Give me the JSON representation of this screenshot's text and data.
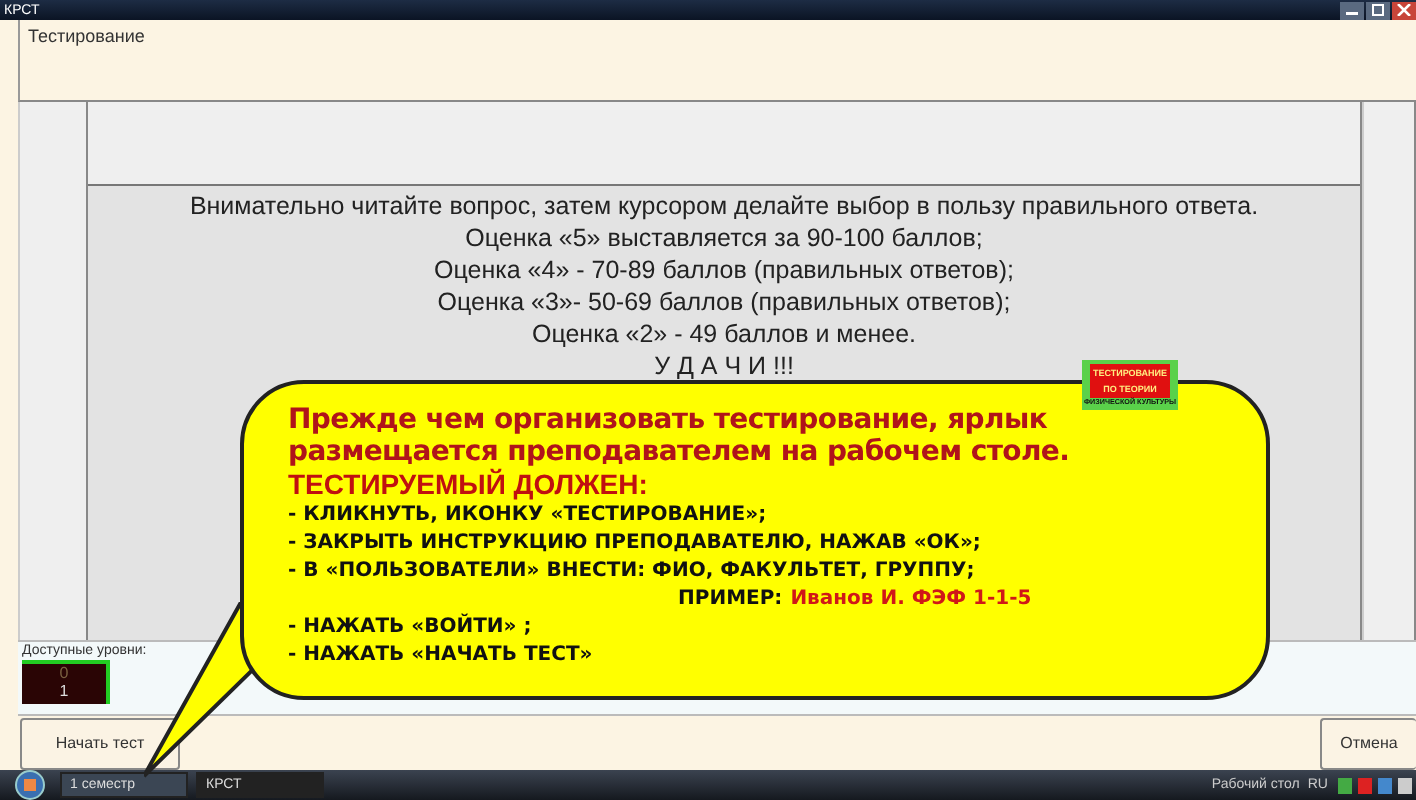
{
  "window": {
    "title": "КРСТ"
  },
  "header": {
    "title": "Тестирование"
  },
  "instructions": [
    "Внимательно читайте вопрос, затем курсором делайте выбор в пользу правильного ответа.",
    "Оценка «5» выставляется за 90-100 баллов;",
    "Оценка «4» - 70-89 баллов (правильных ответов);",
    "Оценка «3»- 50-69 баллов (правильных ответов);",
    "Оценка «2» - 49 баллов и менее.",
    "У Д А Ч И !!!"
  ],
  "levels": {
    "label": "Доступные уровни:",
    "items": [
      "0",
      "1"
    ]
  },
  "buttons": {
    "start": "Начать тест",
    "cancel": "Отмена"
  },
  "callout": {
    "intro": "Прежде чем организовать тестирование, ярлык размещается преподавателем на рабочем столе.",
    "heading": "ТЕСТИРУЕМЫЙ ДОЛЖЕН:",
    "logo": [
      "ТЕСТИРОВАНИЕ",
      "ПО ТЕОРИИ",
      "ФИЗИЧЕСКОЙ КУЛЬТУРЫ"
    ],
    "steps": [
      {
        "kind": "plain",
        "text": "- КЛИКНУТЬ, ИКОНКУ «ТЕСТИРОВАНИЕ»;"
      },
      {
        "kind": "plain",
        "text": "- ЗАКРЫТЬ ИНСТРУКЦИЮ ПРЕПОДАВАТЕЛЮ, НАЖАВ «ОК»;"
      },
      {
        "kind": "plain",
        "text": "- В «ПОЛЬЗОВАТЕЛИ» ВНЕСТИ: ФИО, ФАКУЛЬТЕТ, ГРУППУ;"
      },
      {
        "kind": "example",
        "label": "ПРИМЕР:",
        "value": "Иванов И. ФЭФ 1-1-5"
      },
      {
        "kind": "plain",
        "text": "- НАЖАТЬ «ВОЙТИ» ;"
      },
      {
        "kind": "plain",
        "text": "- НАЖАТЬ «НАЧАТЬ ТЕСТ»"
      }
    ]
  },
  "taskbar": {
    "items": [
      {
        "label": "1 семестр",
        "selected": false
      },
      {
        "label": "КРСТ",
        "selected": true
      }
    ],
    "desktop": "Рабочий стол",
    "language": "RU"
  }
}
